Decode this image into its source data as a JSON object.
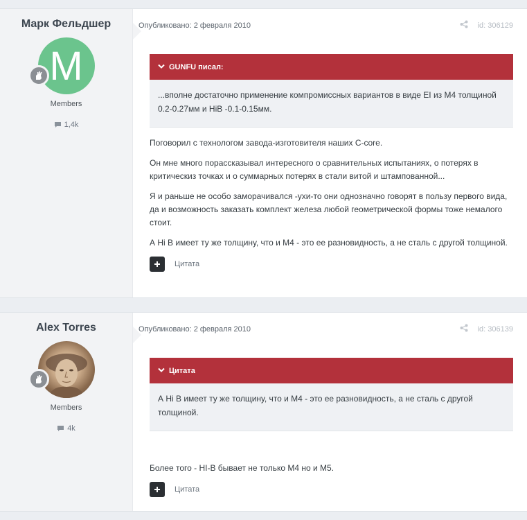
{
  "posts": [
    {
      "author": "Марк Фельдшер",
      "avatar_letter": "M",
      "avatar_color": "#6bc48d",
      "group": "Members",
      "reputation": "1,4k",
      "date": "Опубликовано: 2 февраля 2010",
      "id": "id: 306129",
      "quote_title": "GUNFU писал:",
      "quote_text": "...вполне достаточно применение компромиссных вариантов в виде EI из М4 толщиной 0.2-0.27мм и HiB -0.1-0.15мм.",
      "paragraphs": [
        "Поговорил с технологом завода-изготовителя наших С-core.",
        "Он мне много порассказывал интересного о сравнительных испытаниях, о потерях в критическиз точках и о суммарных потерях в стали витой и штампованной...",
        "Я и раньше не особо заморачивался -ухи-то они однозначно говорят в пользу первого вида, да и возможность заказать комплект железа любой геометрической формы тоже немалого стоит.",
        "А Hi B имеет ту же толщину, что и М4 - это ее разновидность, а не сталь с другой толщиной."
      ],
      "quote_action": "Цитата"
    },
    {
      "author": "Alex Torres",
      "group": "Members",
      "reputation": "4k",
      "date": "Опубликовано: 2 февраля 2010",
      "id": "id: 306139",
      "quote_title": "Цитата",
      "quote_text": "А Hi B имеет ту же толщину, что и М4 - это ее разновидность, а не сталь с другой толщиной.",
      "paragraphs": [
        "Более того - HI-B бывает не только М4 но и М5."
      ],
      "quote_action": "Цитата"
    }
  ],
  "icons": {
    "badge": "rank-badge-icon",
    "comment": "comment-icon",
    "share": "share-icon",
    "chevron": "chevron-down-icon",
    "plus": "plus-icon"
  },
  "colors": {
    "quote_header": "#b3313b",
    "avatar_green": "#6bc48d"
  }
}
